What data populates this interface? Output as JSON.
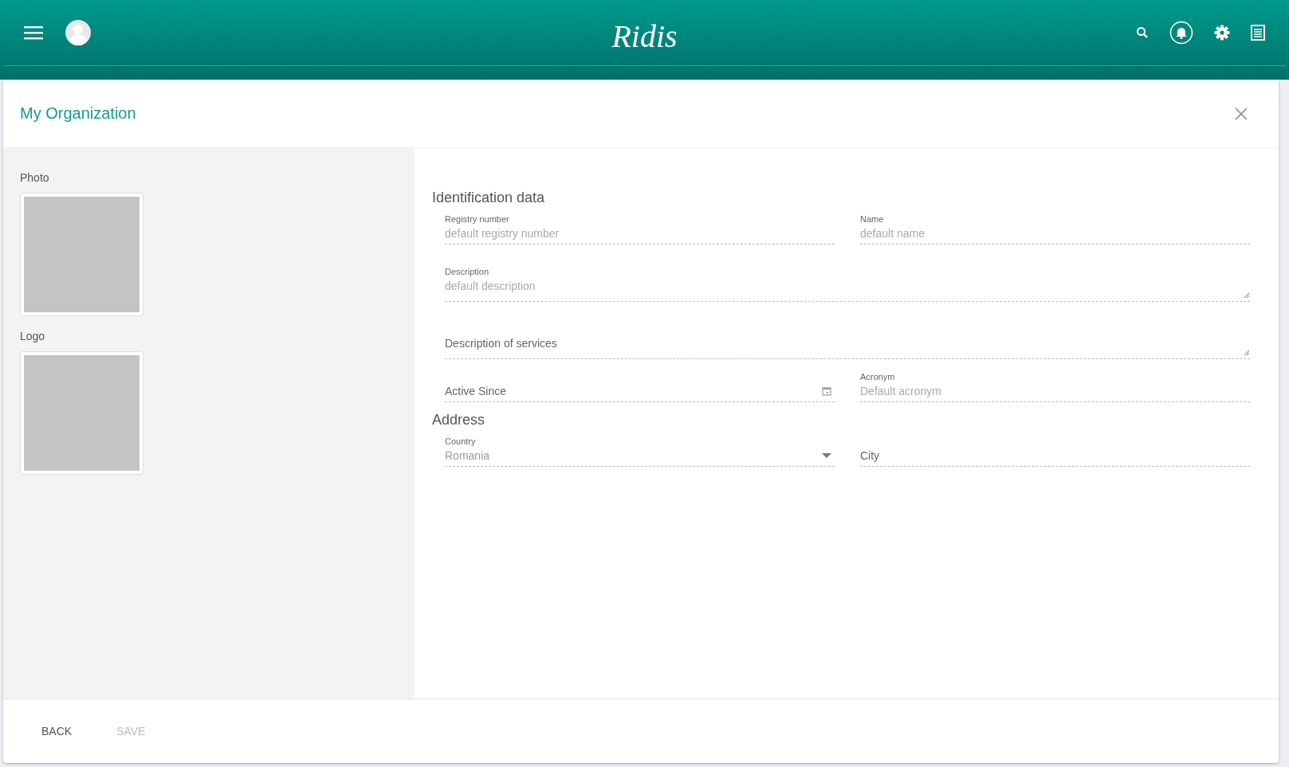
{
  "app_bar": {
    "logo": "Ridis"
  },
  "dialog": {
    "title": "My Organization"
  },
  "media": [
    {
      "label": "Photo"
    },
    {
      "label": "Logo"
    }
  ],
  "sections": [
    {
      "title": "Identification data",
      "rows": [
        [
          {
            "kind": "text",
            "label": "Registry number",
            "placeholder": "default registry number"
          },
          {
            "kind": "text",
            "label": "Name",
            "placeholder": "default name"
          }
        ],
        [
          {
            "kind": "textarea",
            "label": "Description",
            "placeholder": "default description"
          }
        ],
        [
          {
            "kind": "textarea",
            "placeholder": "Description of services"
          }
        ],
        [
          {
            "kind": "date",
            "placeholder": "Active Since"
          },
          {
            "kind": "text",
            "label": "Acronym",
            "placeholder": "Default acronym"
          }
        ]
      ]
    },
    {
      "title": "Address",
      "rows": [
        [
          {
            "kind": "select",
            "label": "Country",
            "value": "Romania"
          },
          {
            "kind": "text",
            "placeholder": "City"
          }
        ]
      ]
    }
  ],
  "buttons": [
    {
      "label": "BACK",
      "disabled": false
    },
    {
      "label": "SAVE",
      "disabled": true
    }
  ]
}
